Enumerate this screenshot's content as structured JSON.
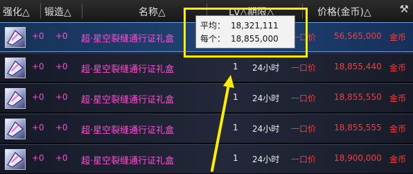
{
  "header": {
    "col_enhance": "强化△",
    "col_forge": "锻造△",
    "col_name": "名称△",
    "col_level_period": "Lv△期限△",
    "col_price": "价格(金币)△",
    "hammer_icon": "hammer-icon"
  },
  "tooltip": {
    "avg_label": "平均：",
    "avg_value": "18,321,111",
    "each_label": "每个：",
    "each_value": "18,855,000"
  },
  "rows": [
    {
      "enhance": "+0",
      "forge": "+0",
      "name": "超·星空裂缝通行证礼盒",
      "level": "",
      "period": "",
      "sale_type": "一口价",
      "price": "56,565,000",
      "currency": "金币"
    },
    {
      "enhance": "+0",
      "forge": "+0",
      "name": "超·星空裂缝通行证礼盒",
      "level": "1",
      "period": "24小时",
      "sale_type": "一口价",
      "price": "18,855,440",
      "currency": "金币"
    },
    {
      "enhance": "+0",
      "forge": "+0",
      "name": "超·星空裂缝通行证礼盒",
      "level": "1",
      "period": "24小时",
      "sale_type": "一口价",
      "price": "18,855,550",
      "currency": "金币"
    },
    {
      "enhance": "+0",
      "forge": "+0",
      "name": "超·星空裂缝通行证礼盒",
      "level": "1",
      "period": "24小时",
      "sale_type": "一口价",
      "price": "18,855,555",
      "currency": "金币"
    },
    {
      "enhance": "+0",
      "forge": "+0",
      "name": "超·星空裂缝通行证礼盒",
      "level": "1",
      "period": "24小时",
      "sale_type": "一口价",
      "price": "18,900,000",
      "currency": "金币"
    }
  ],
  "colors": {
    "highlight": "#ffee00",
    "item_name": "#ff4cd2",
    "price": "#ff3a3a"
  }
}
